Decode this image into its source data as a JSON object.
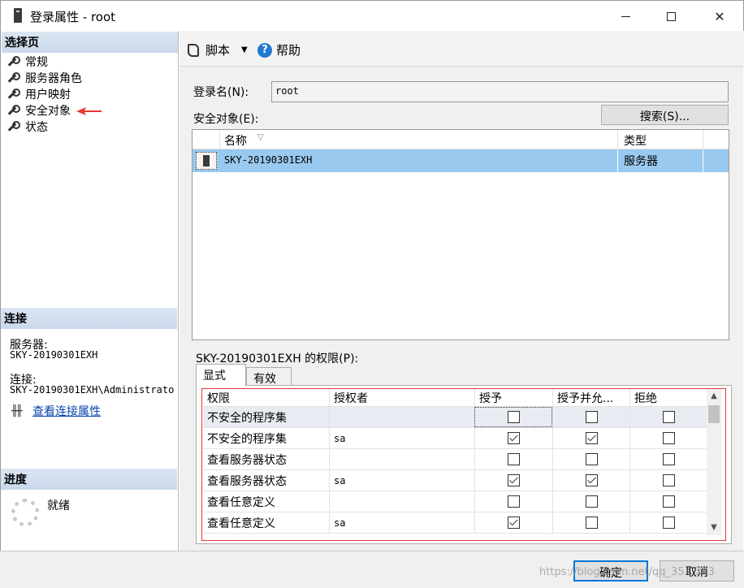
{
  "window": {
    "title": "登录属性 - root"
  },
  "left": {
    "select_page_header": "选择页",
    "pages": [
      "常规",
      "服务器角色",
      "用户映射",
      "安全对象",
      "状态"
    ],
    "connection_header": "连接",
    "server_label": "服务器:",
    "server_value": "SKY-20190301EXH",
    "connection_label": "连接:",
    "connection_value": "SKY-20190301EXH\\Administrato",
    "view_props_link": "查看连接属性",
    "progress_header": "进度",
    "progress_status": "就绪"
  },
  "toolbar": {
    "script_label": "脚本",
    "help_label": "帮助"
  },
  "main": {
    "login_name_label": "登录名(N):",
    "login_name_value": "root",
    "securables_label": "安全对象(E):",
    "search_button": "搜索(S)...",
    "list_headers": {
      "name": "名称",
      "type": "类型"
    },
    "list_rows": [
      {
        "name": "SKY-20190301EXH",
        "type": "服务器"
      }
    ],
    "permissions_title": "SKY-20190301EXH 的权限(P):",
    "tabs": [
      "显式",
      "有效"
    ],
    "grid_headers": [
      "权限",
      "授权者",
      "授予",
      "授予并允...",
      "拒绝"
    ],
    "grid_rows": [
      {
        "permission": "不安全的程序集",
        "grantor": "",
        "grant": false,
        "with_grant": false,
        "deny": false
      },
      {
        "permission": "不安全的程序集",
        "grantor": "sa",
        "grant": true,
        "with_grant": true,
        "deny": false
      },
      {
        "permission": "查看服务器状态",
        "grantor": "",
        "grant": false,
        "with_grant": false,
        "deny": false
      },
      {
        "permission": "查看服务器状态",
        "grantor": "sa",
        "grant": true,
        "with_grant": true,
        "deny": false
      },
      {
        "permission": "查看任意定义",
        "grantor": "",
        "grant": false,
        "with_grant": false,
        "deny": false
      },
      {
        "permission": "查看任意定义",
        "grantor": "sa",
        "grant": true,
        "with_grant": false,
        "deny": false
      }
    ]
  },
  "footer": {
    "ok_button": "确定",
    "cancel_button": "取消",
    "watermark": "https://blog.csdn.net/qq_35...743"
  }
}
